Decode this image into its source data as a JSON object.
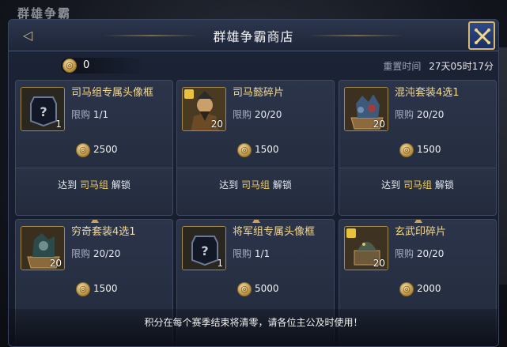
{
  "background": {
    "title": "群雄争霸"
  },
  "dialog": {
    "title": "群雄争霸商店"
  },
  "currency": {
    "amount": "0"
  },
  "reset": {
    "label": "重置时间",
    "time": "27天05时17分"
  },
  "items": [
    {
      "name": "司马组专属头像框",
      "limit_label": "限购",
      "limit": "1/1",
      "count": "1",
      "price": "2500",
      "icon": "avatar-frame-icon",
      "unlock_prefix": "达到",
      "unlock_group": "司马组",
      "unlock_suffix": "解锁"
    },
    {
      "name": "司马懿碎片",
      "limit_label": "限购",
      "limit": "20/20",
      "count": "20",
      "price": "1500",
      "icon": "hero-fragment-icon",
      "unlock_prefix": "达到",
      "unlock_group": "司马组",
      "unlock_suffix": "解锁"
    },
    {
      "name": "混沌套装4选1",
      "limit_label": "限购",
      "limit": "20/20",
      "count": "20",
      "price": "1500",
      "icon": "equipment-chest-icon",
      "unlock_prefix": "达到",
      "unlock_group": "司马组",
      "unlock_suffix": "解锁"
    },
    {
      "name": "穷奇套装4选1",
      "limit_label": "限购",
      "limit": "20/20",
      "count": "20",
      "price": "1500",
      "icon": "equipment-chest-icon"
    },
    {
      "name": "将军组专属头像框",
      "limit_label": "限购",
      "limit": "1/1",
      "count": "1",
      "price": "5000",
      "icon": "avatar-frame-icon"
    },
    {
      "name": "玄武印碎片",
      "limit_label": "限购",
      "limit": "20/20",
      "count": "20",
      "price": "2000",
      "icon": "seal-fragment-icon"
    }
  ],
  "footer": {
    "notice": "积分在每个赛季结束将清零，请各位主公及时使用！"
  },
  "colors": {
    "accent_gold": "#f1cc59",
    "item_name": "#f4d893",
    "panel": "#1c2437"
  }
}
